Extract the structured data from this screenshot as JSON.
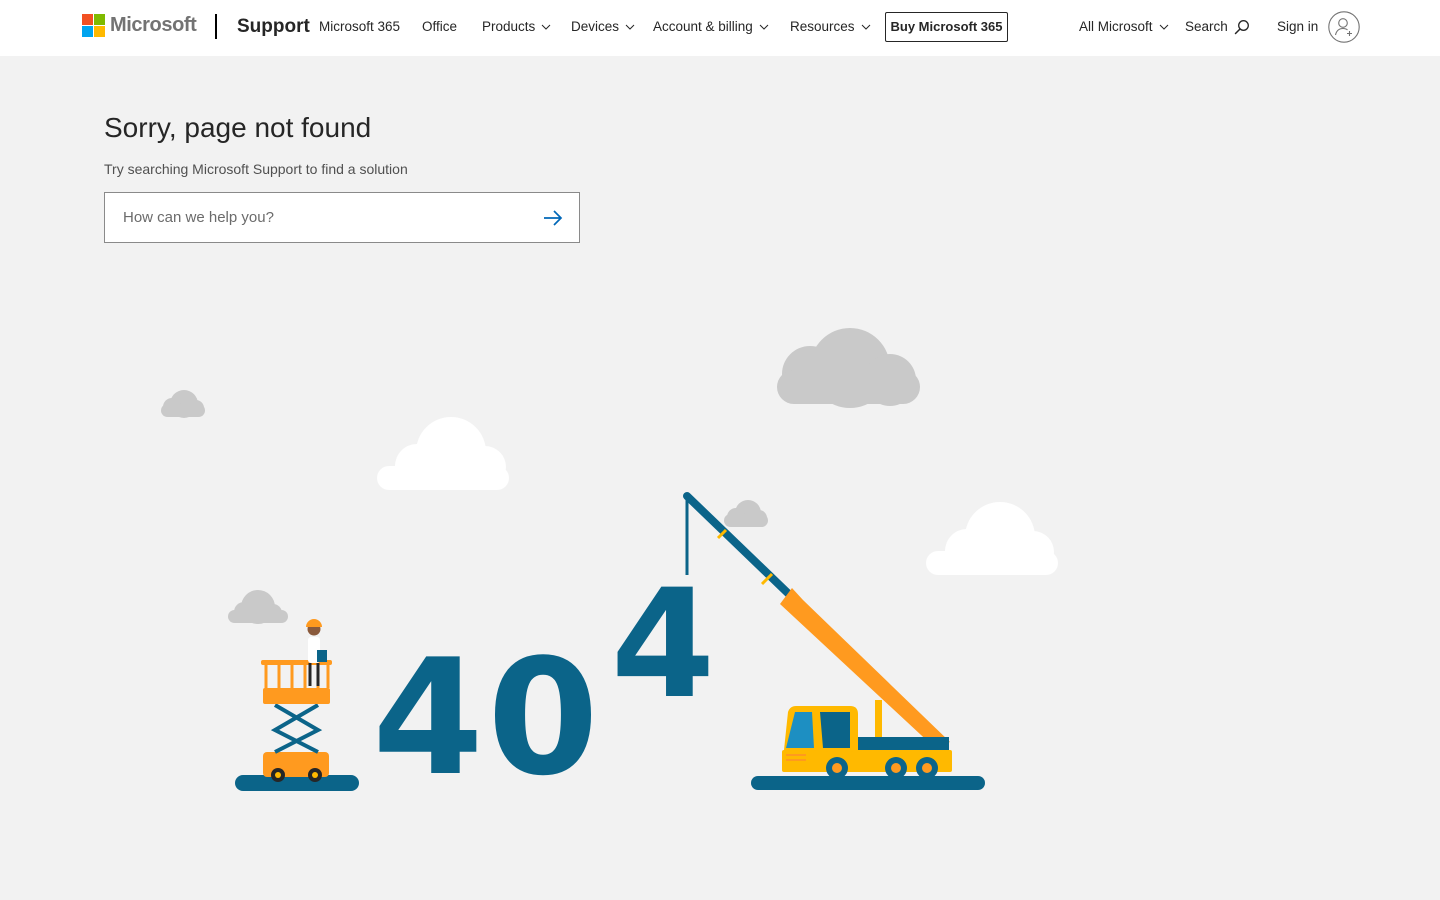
{
  "header": {
    "brand": "Microsoft",
    "support": "Support",
    "nav": [
      {
        "label": "Microsoft 365",
        "dropdown": false
      },
      {
        "label": "Office",
        "dropdown": false
      },
      {
        "label": "Products",
        "dropdown": true
      },
      {
        "label": "Devices",
        "dropdown": true
      },
      {
        "label": "Account & billing",
        "dropdown": true
      },
      {
        "label": "Resources",
        "dropdown": true
      }
    ],
    "buy_label": "Buy Microsoft 365",
    "all_microsoft": "All Microsoft",
    "search_label": "Search",
    "signin_label": "Sign in"
  },
  "main": {
    "title": "Sorry, page not found",
    "subtitle": "Try searching Microsoft Support to find a solution",
    "search_placeholder": "How can we help you?",
    "search_value": ""
  },
  "illustration": {
    "digits": [
      "4",
      "0",
      "4"
    ]
  },
  "colors": {
    "logo_red": "#f25022",
    "logo_green": "#7fba00",
    "logo_blue": "#00a4ef",
    "logo_yellow": "#ffb900",
    "accent": "#0067b8",
    "digit_blue": "#0b6489",
    "crane_orange": "#ff9a1f"
  }
}
